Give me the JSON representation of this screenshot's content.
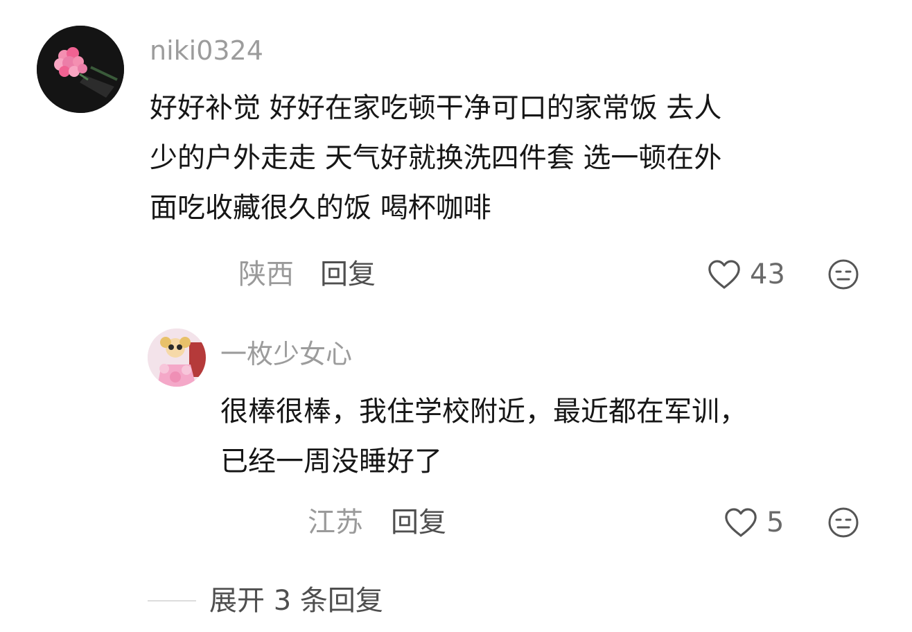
{
  "comment": {
    "username": "niki0324",
    "text_lines": [
      "好好补觉 好好在家吃顿干净可口的家常饭 去人",
      "少的户外走走 天气好就换洗四件套 选一顿在外",
      "面吃收藏很久的饭 喝杯咖啡"
    ],
    "location": "陕西",
    "reply_label": "回复",
    "like_count": "43",
    "avatar_icon": "pink-roses-avatar"
  },
  "reply": {
    "username": "一枚少女心",
    "text_lines": [
      "很棒很棒，我住学校附近，最近都在军训，",
      "已经一周没睡好了"
    ],
    "location": "江苏",
    "reply_label": "回复",
    "like_count": "5",
    "avatar_icon": "cartoon-girl-avatar"
  },
  "expand_replies_label": "展开 3 条回复",
  "colors": {
    "muted_text": "#9a9a9a",
    "body_text": "#161616",
    "action_text": "#4f4f4f",
    "icon_stroke": "#555555"
  }
}
